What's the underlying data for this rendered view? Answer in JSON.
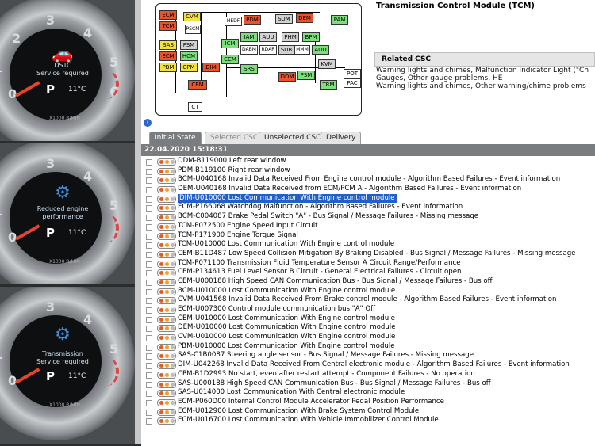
{
  "gauges": [
    {
      "icon": "car-skid-icon",
      "line1": "DSTC",
      "line2": "Service required",
      "gear": "P",
      "temp": "11°C",
      "unit": "X1000 R/MIN"
    },
    {
      "icon": "engine-icon",
      "line1": "Reduced engine",
      "line2": "performance",
      "gear": "P",
      "temp": "11°C",
      "unit": "X1000 R/MIN"
    },
    {
      "icon": "gear-wrench-icon",
      "line1": "Transmission",
      "line2": "Service required",
      "gear": "P",
      "temp": "11°C",
      "unit": "X1000 R/MIN"
    }
  ],
  "dial_numbers": [
    "2",
    "3",
    "4",
    "5",
    "6",
    "0",
    "1",
    "0"
  ],
  "diagram": {
    "nodes": [
      {
        "label": "ECM",
        "color": "red"
      },
      {
        "label": "TCM",
        "color": "red"
      },
      {
        "label": "CVM",
        "color": "yellow"
      },
      {
        "label": "PSCM",
        "color": "white"
      },
      {
        "label": "HEDF",
        "color": "white"
      },
      {
        "label": "PDM",
        "color": "red"
      },
      {
        "label": "SUM",
        "color": "gray"
      },
      {
        "label": "DEM",
        "color": "red"
      },
      {
        "label": "PAM",
        "color": "green"
      },
      {
        "label": "SAS",
        "color": "yellow"
      },
      {
        "label": "ECM",
        "color": "red"
      },
      {
        "label": "PBM",
        "color": "yellow"
      },
      {
        "label": "FSM",
        "color": "gray"
      },
      {
        "label": "HCM",
        "color": "green"
      },
      {
        "label": "CPM",
        "color": "yellow"
      },
      {
        "label": "DIM",
        "color": "red"
      },
      {
        "label": "ICM",
        "color": "green"
      },
      {
        "label": "IAM",
        "color": "green"
      },
      {
        "label": "AUU",
        "color": "gray"
      },
      {
        "label": "PHM",
        "color": "gray"
      },
      {
        "label": "BPM",
        "color": "green"
      },
      {
        "label": "CCM",
        "color": "green"
      },
      {
        "label": "DABM",
        "color": "white"
      },
      {
        "label": "RDAR",
        "color": "white"
      },
      {
        "label": "SUB",
        "color": "gray"
      },
      {
        "label": "MMM",
        "color": "white"
      },
      {
        "label": "AUD",
        "color": "green"
      },
      {
        "label": "KVM",
        "color": "gray"
      },
      {
        "label": "SRS",
        "color": "green"
      },
      {
        "label": "CEM",
        "color": "red"
      },
      {
        "label": "DDM",
        "color": "red"
      },
      {
        "label": "PSM",
        "color": "green"
      },
      {
        "label": "POT",
        "color": "white"
      },
      {
        "label": "TRM",
        "color": "green"
      },
      {
        "label": "PAC",
        "color": "white"
      },
      {
        "label": "CT",
        "color": "white"
      }
    ]
  },
  "title": "Transmission Control Module (TCM)",
  "related_csc": {
    "header": "Related CSC",
    "lines": [
      "Warning lights and chimes, Malfunction Indicator Light (\"Ch",
      "Gauges, Other gauge problems, HE",
      "Warning lights and chimes, Other warning/chime problems"
    ]
  },
  "tabs": [
    "Initial State",
    "Selected CSC",
    "Unselected CSC",
    "Delivery"
  ],
  "timestamp": "22.04.2020 15:18:31",
  "dtc_rows": [
    "DDM-B119000 Left rear window",
    "PDM-B119100 Right rear window",
    "BCM-U040168 Invalid Data Received From Engine control module - Algorithm Based Failures - Event information",
    "DEM-U040168 Invalid Data Received from  ECM/PCM A - Algorithm Based Failures - Event information",
    "DIM-U010000 Lost Communication With Engine control module",
    "ECM-P166068 Watchdog Malfunction - Algorithm Based Failures - Event information",
    "BCM-C004087 Brake Pedal Switch \"A\"  - Bus Signal / Message Failures - Missing message",
    "TCM-P072500 Engine Speed Input Circuit",
    "TCM-P171900 Engine Torque Signal",
    "TCM-U010000 Lost Communication With Engine control module",
    "CEM-B11D487 Low Speed Collision Mitigation By Braking Disabled - Bus Signal / Message Failures - Missing message",
    "TCM-P071100 Transmission Fluid Temperature Sensor A Circuit Range/Performance",
    "CEM-P134613 Fuel Level Sensor B Circuit - General Electrical Failures - Circuit open",
    "CEM-U000188 High Speed CAN Communication Bus - Bus Signal / Message Failures - Bus off",
    "BCM-U010000 Lost Communication With Engine control module",
    "CVM-U041568 Invalid Data Received From Brake control module - Algorithm Based Failures - Event information",
    "ECM-U007300 Control module communication bus \"A\" Off",
    "CEM-U010000 Lost Communication With Engine control module",
    "DEM-U010000 Lost Communication With Engine control module",
    "CVM-U010000 Lost Communication With Engine control module",
    "PBM-U010000 Lost Communication With Engine control module",
    "SAS-C1B0087 Steering angle sensor - Bus Signal / Message Failures - Missing message",
    "DIM-U042268 Invalid Data Received From Central electronic module - Algorithm Based Failures - Event information",
    "CPM-B1D2993 No start, even after restart attempt - Component Failures - No operation",
    "SAS-U000188 High Speed CAN Communication Bus - Bus Signal / Message Failures - Bus off",
    "SAS-U014000 Lost Communication With Central electronic module",
    "ECM-P060D00 Internal Control Module Accelerator Pedal Position Performance",
    "ECM-U012900 Lost Communication With Brake System Control Module",
    "ECM-U016700 Lost Communication With Vehicle Immobilizer Control Module"
  ],
  "selected_row": 4,
  "colors": {
    "selection": "#2060c8",
    "tab_active": "#7a7d80",
    "fault_red": "#e8532b",
    "ok_green": "#7be07b",
    "warn_yellow": "#f4e23c"
  }
}
